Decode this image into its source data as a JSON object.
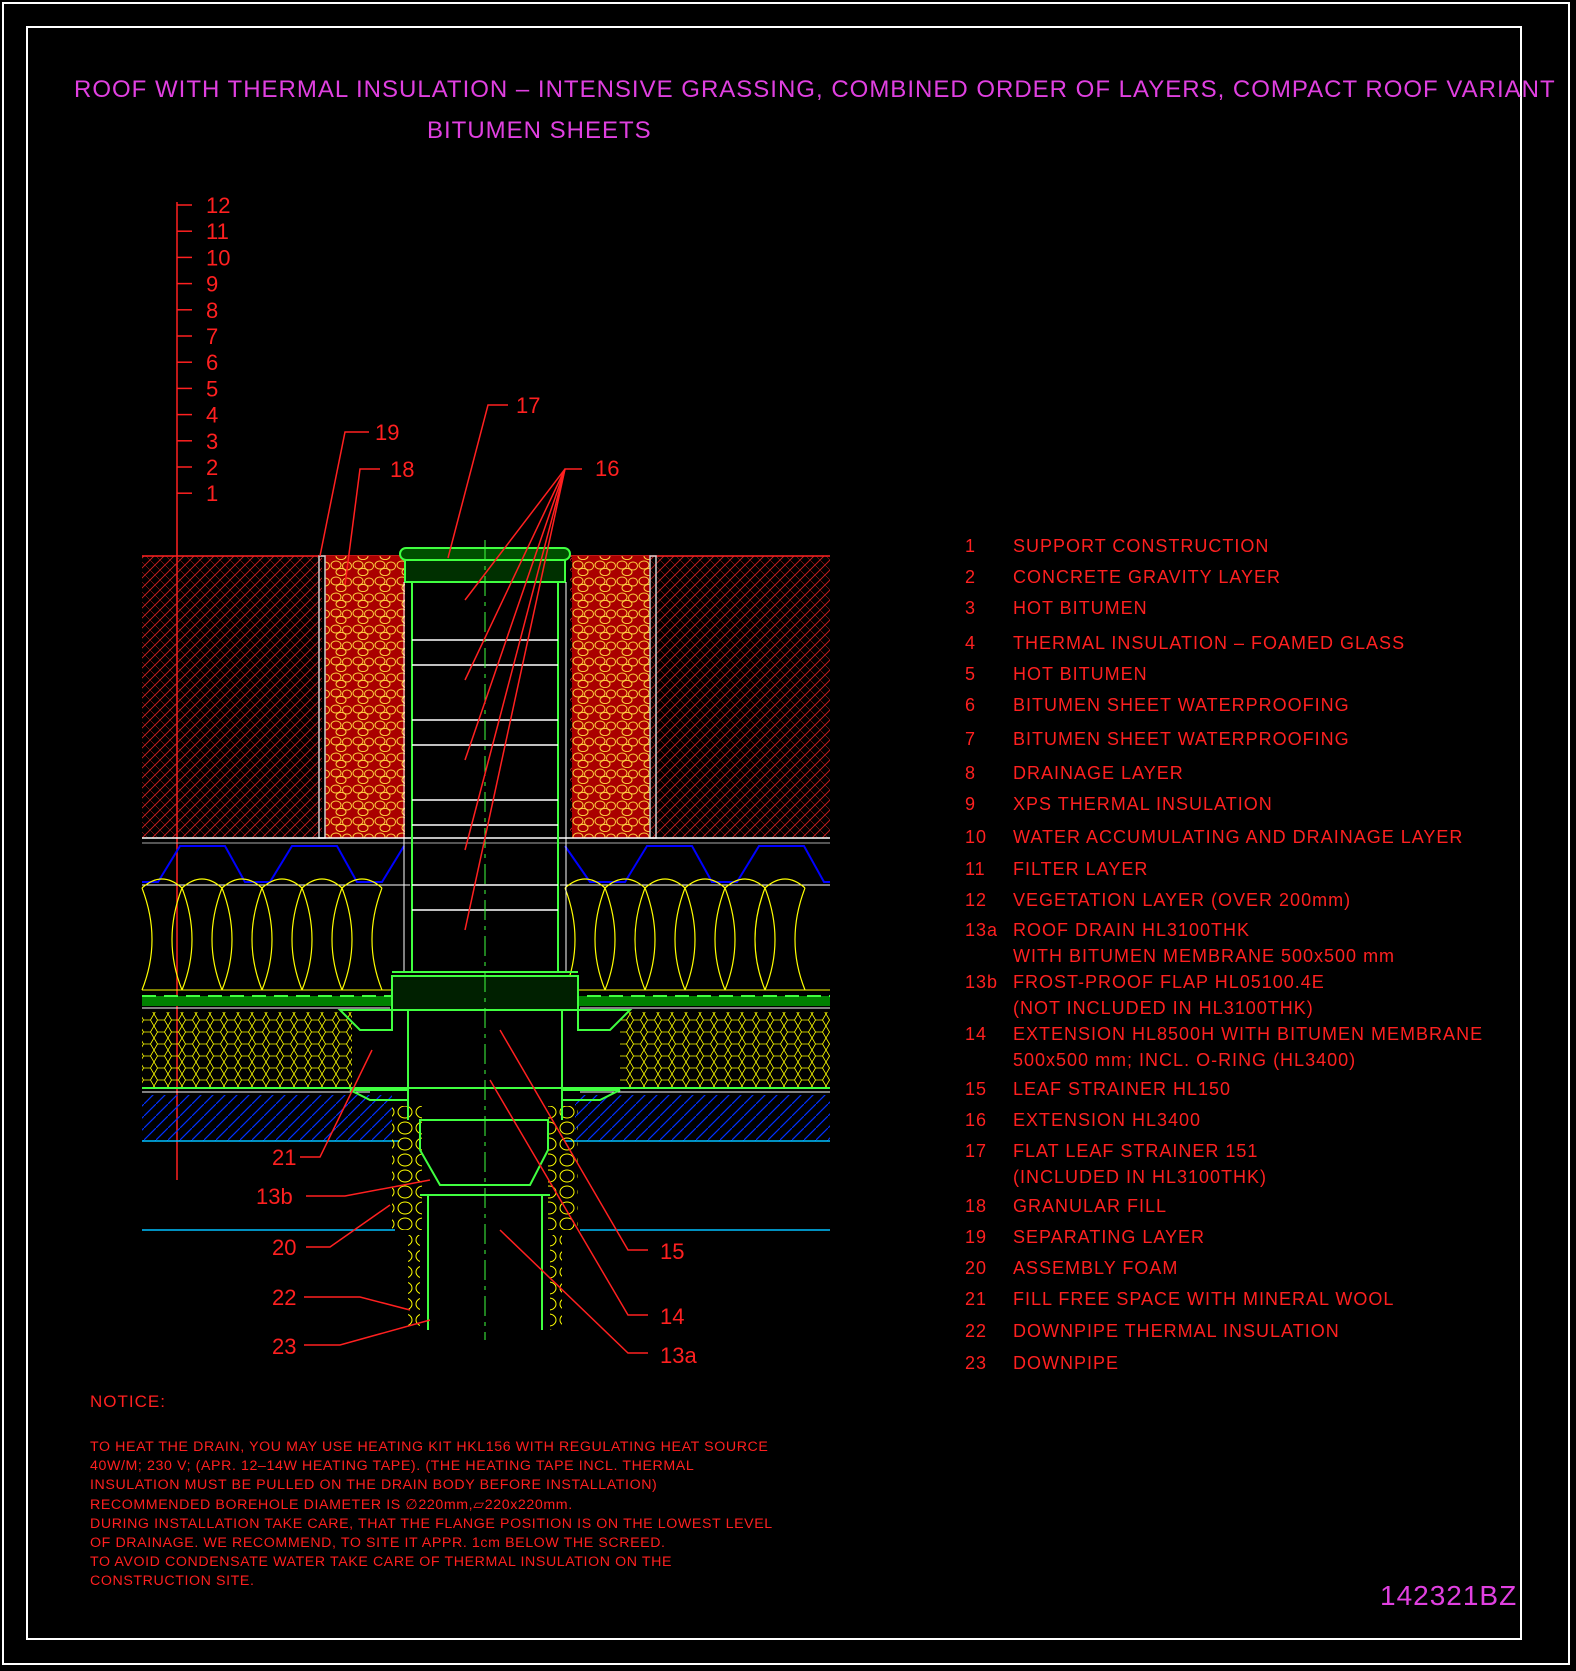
{
  "title": {
    "line1": "ROOF WITH THERMAL INSULATION – INTENSIVE GRASSING, COMBINED ORDER OF LAYERS, COMPACT ROOF VARIANT",
    "line2": "BITUMEN SHEETS"
  },
  "layer_scale": [
    "12",
    "11",
    "10",
    "9",
    "8",
    "7",
    "6",
    "5",
    "4",
    "3",
    "2",
    "1"
  ],
  "callouts": {
    "c17": "17",
    "c16": "16",
    "c19": "19",
    "c18": "18",
    "c21": "21",
    "c13b": "13b",
    "c20": "20",
    "c22": "22",
    "c23": "23",
    "c15": "15",
    "c14": "14",
    "c13a": "13a"
  },
  "legend": [
    {
      "num": "1",
      "text": "SUPPORT CONSTRUCTION"
    },
    {
      "num": "2",
      "text": "CONCRETE GRAVITY LAYER"
    },
    {
      "num": "3",
      "text": "HOT BITUMEN"
    },
    {
      "num": "4",
      "text": "THERMAL INSULATION – FOAMED GLASS"
    },
    {
      "num": "5",
      "text": "HOT BITUMEN"
    },
    {
      "num": "6",
      "text": "BITUMEN SHEET WATERPROOFING"
    },
    {
      "num": "7",
      "text": "BITUMEN SHEET WATERPROOFING"
    },
    {
      "num": "8",
      "text": "DRAINAGE LAYER"
    },
    {
      "num": "9",
      "text": "XPS THERMAL INSULATION"
    },
    {
      "num": "10",
      "text": "WATER ACCUMULATING AND DRAINAGE LAYER"
    },
    {
      "num": "11",
      "text": "FILTER LAYER"
    },
    {
      "num": "12",
      "text": "VEGETATION LAYER (OVER 200mm)"
    },
    {
      "num": "13a",
      "text": "ROOF DRAIN HL3100THK",
      "text2": "WITH BITUMEN MEMBRANE 500x500 mm"
    },
    {
      "num": "13b",
      "text": "FROST-PROOF FLAP HL05100.4E",
      "text2": "(NOT INCLUDED IN HL3100THK)"
    },
    {
      "num": "14",
      "text": "EXTENSION HL8500H WITH BITUMEN MEMBRANE",
      "text2": "500x500 mm; INCL. O-RING (HL3400)"
    },
    {
      "num": "15",
      "text": "LEAF STRAINER HL150"
    },
    {
      "num": "16",
      "text": "EXTENSION HL3400"
    },
    {
      "num": "17",
      "text": "FLAT LEAF STRAINER 151",
      "text2": "(INCLUDED IN HL3100THK)"
    },
    {
      "num": "18",
      "text": "GRANULAR FILL"
    },
    {
      "num": "19",
      "text": "SEPARATING LAYER"
    },
    {
      "num": "20",
      "text": "ASSEMBLY FOAM"
    },
    {
      "num": "21",
      "text": "FILL FREE SPACE WITH MINERAL WOOL"
    },
    {
      "num": "22",
      "text": "DOWNPIPE THERMAL INSULATION"
    },
    {
      "num": "23",
      "text": "DOWNPIPE"
    }
  ],
  "notice": {
    "heading": "NOTICE:",
    "lines": [
      "TO HEAT THE DRAIN, YOU MAY USE HEATING KIT HKL156 WITH REGULATING HEAT SOURCE",
      "40W/M; 230 V;   (APR. 12–14W HEATING TAPE). (THE HEATING TAPE INCL. THERMAL",
      "INSULATION MUST BE PULLED ON THE DRAIN BODY BEFORE INSTALLATION)",
      "RECOMMENDED BOREHOLE DIAMETER IS ∅220mm,▱220x220mm.",
      "DURING INSTALLATION TAKE CARE, THAT THE FLANGE POSITION IS ON THE LOWEST LEVEL",
      "OF DRAINAGE. WE RECOMMEND, TO SITE IT APPR. 1cm BELOW THE SCREED.",
      "TO AVOID CONDENSATE WATER TAKE CARE OF THERMAL INSULATION ON THE",
      "CONSTRUCTION SITE."
    ]
  },
  "drawing_code": "142321BZ",
  "colors": {
    "title": "#e040e0",
    "label": "#ff2020",
    "drain": "#40ff40",
    "insulation": "#ffff00",
    "filter": "#0000ff",
    "membrane": "#00c000",
    "base": "#0030ff",
    "frame": "#ffffff"
  }
}
